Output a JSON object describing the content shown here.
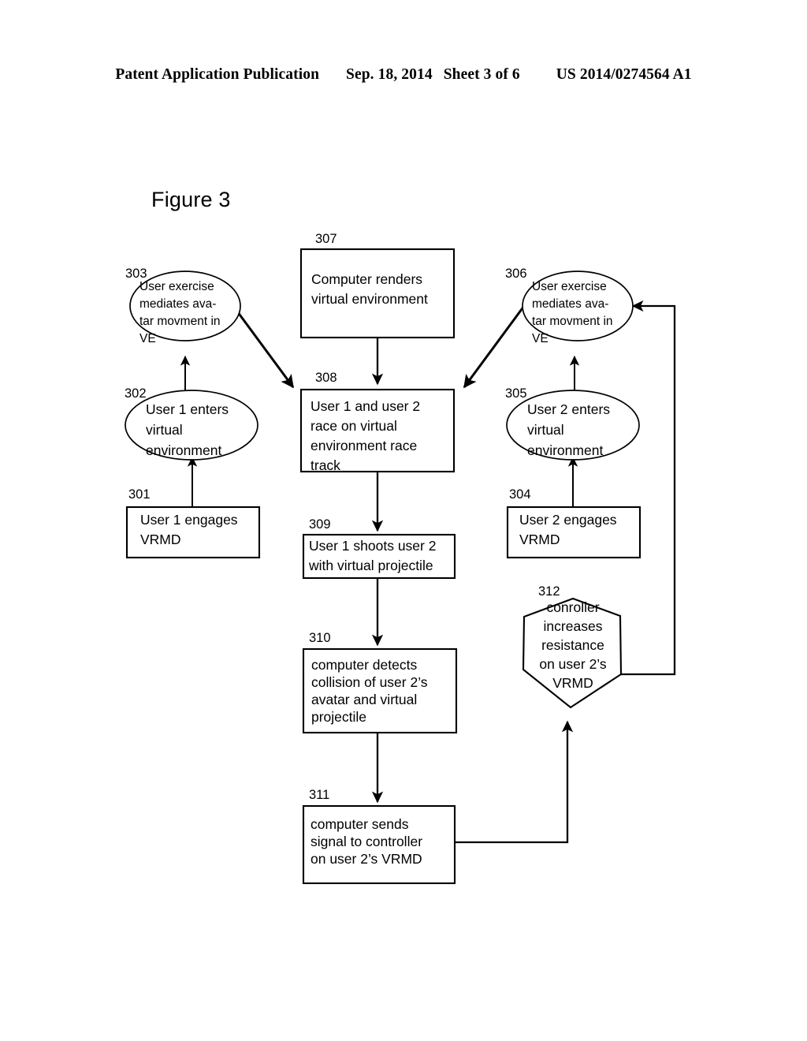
{
  "header": {
    "publication": "Patent Application Publication",
    "date": "Sep. 18, 2014",
    "sheet": "Sheet 3 of 6",
    "number": "US 2014/0274564 A1"
  },
  "figure": {
    "caption": "Figure 3"
  },
  "nodes": {
    "n301": {
      "ref": "301",
      "shape": "rectangle",
      "lines": [
        "User 1 engages",
        "VRMD"
      ]
    },
    "n302": {
      "ref": "302",
      "shape": "ellipse",
      "lines": [
        "User 1 enters",
        "virtual",
        "environment"
      ]
    },
    "n303": {
      "ref": "303",
      "shape": "ellipse",
      "lines": [
        "User exercise",
        "mediates ava-",
        "tar movment in",
        "VE"
      ]
    },
    "n304": {
      "ref": "304",
      "shape": "rectangle",
      "lines": [
        "User 2 engages",
        "VRMD"
      ]
    },
    "n305": {
      "ref": "305",
      "shape": "ellipse",
      "lines": [
        "User 2 enters",
        "virtual",
        "environment"
      ]
    },
    "n306": {
      "ref": "306",
      "shape": "ellipse",
      "lines": [
        "User exercise",
        "mediates ava-",
        "tar movment in",
        "VE"
      ]
    },
    "n307": {
      "ref": "307",
      "shape": "rectangle",
      "lines": [
        "Computer renders",
        "virtual environment"
      ]
    },
    "n308": {
      "ref": "308",
      "shape": "rectangle",
      "lines": [
        "User 1 and user 2",
        "race on virtual",
        "environment race",
        "track"
      ]
    },
    "n309": {
      "ref": "309",
      "shape": "rectangle",
      "lines": [
        "User 1 shoots user 2",
        "with virtual projectile"
      ]
    },
    "n310": {
      "ref": "310",
      "shape": "rectangle",
      "lines": [
        "computer detects",
        "collision of user 2’s",
        "avatar and virtual",
        "projectile"
      ]
    },
    "n311": {
      "ref": "311",
      "shape": "rectangle",
      "lines": [
        "computer sends",
        "signal to controller",
        "on user 2’s VRMD"
      ]
    },
    "n312": {
      "ref": "312",
      "shape": "pentagon",
      "lines": [
        "conroller",
        "increases",
        "resistance",
        "on user 2’s",
        "VRMD"
      ]
    }
  },
  "colors": {
    "ink": "#000000",
    "paper": "#ffffff"
  }
}
